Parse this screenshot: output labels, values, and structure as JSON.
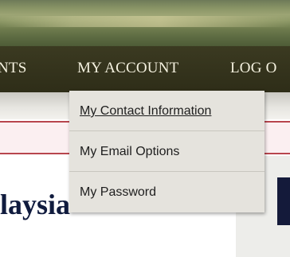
{
  "nav": {
    "items": [
      {
        "label": "NTS"
      },
      {
        "label": "MY ACCOUNT"
      },
      {
        "label": "LOG O"
      }
    ]
  },
  "dropdown": {
    "items": [
      {
        "label": "My Contact Information",
        "hovered": true
      },
      {
        "label": "My Email Options"
      },
      {
        "label": "My Password"
      }
    ]
  },
  "page": {
    "title": "laysia"
  },
  "colors": {
    "navbar": "#2e2d18",
    "nav_text": "#f5f2e0",
    "dropdown_bg": "#e5e3dd",
    "pink_bar": "#fbeff1",
    "pink_bar_border": "#b8454e",
    "title_text": "#101b3e"
  }
}
